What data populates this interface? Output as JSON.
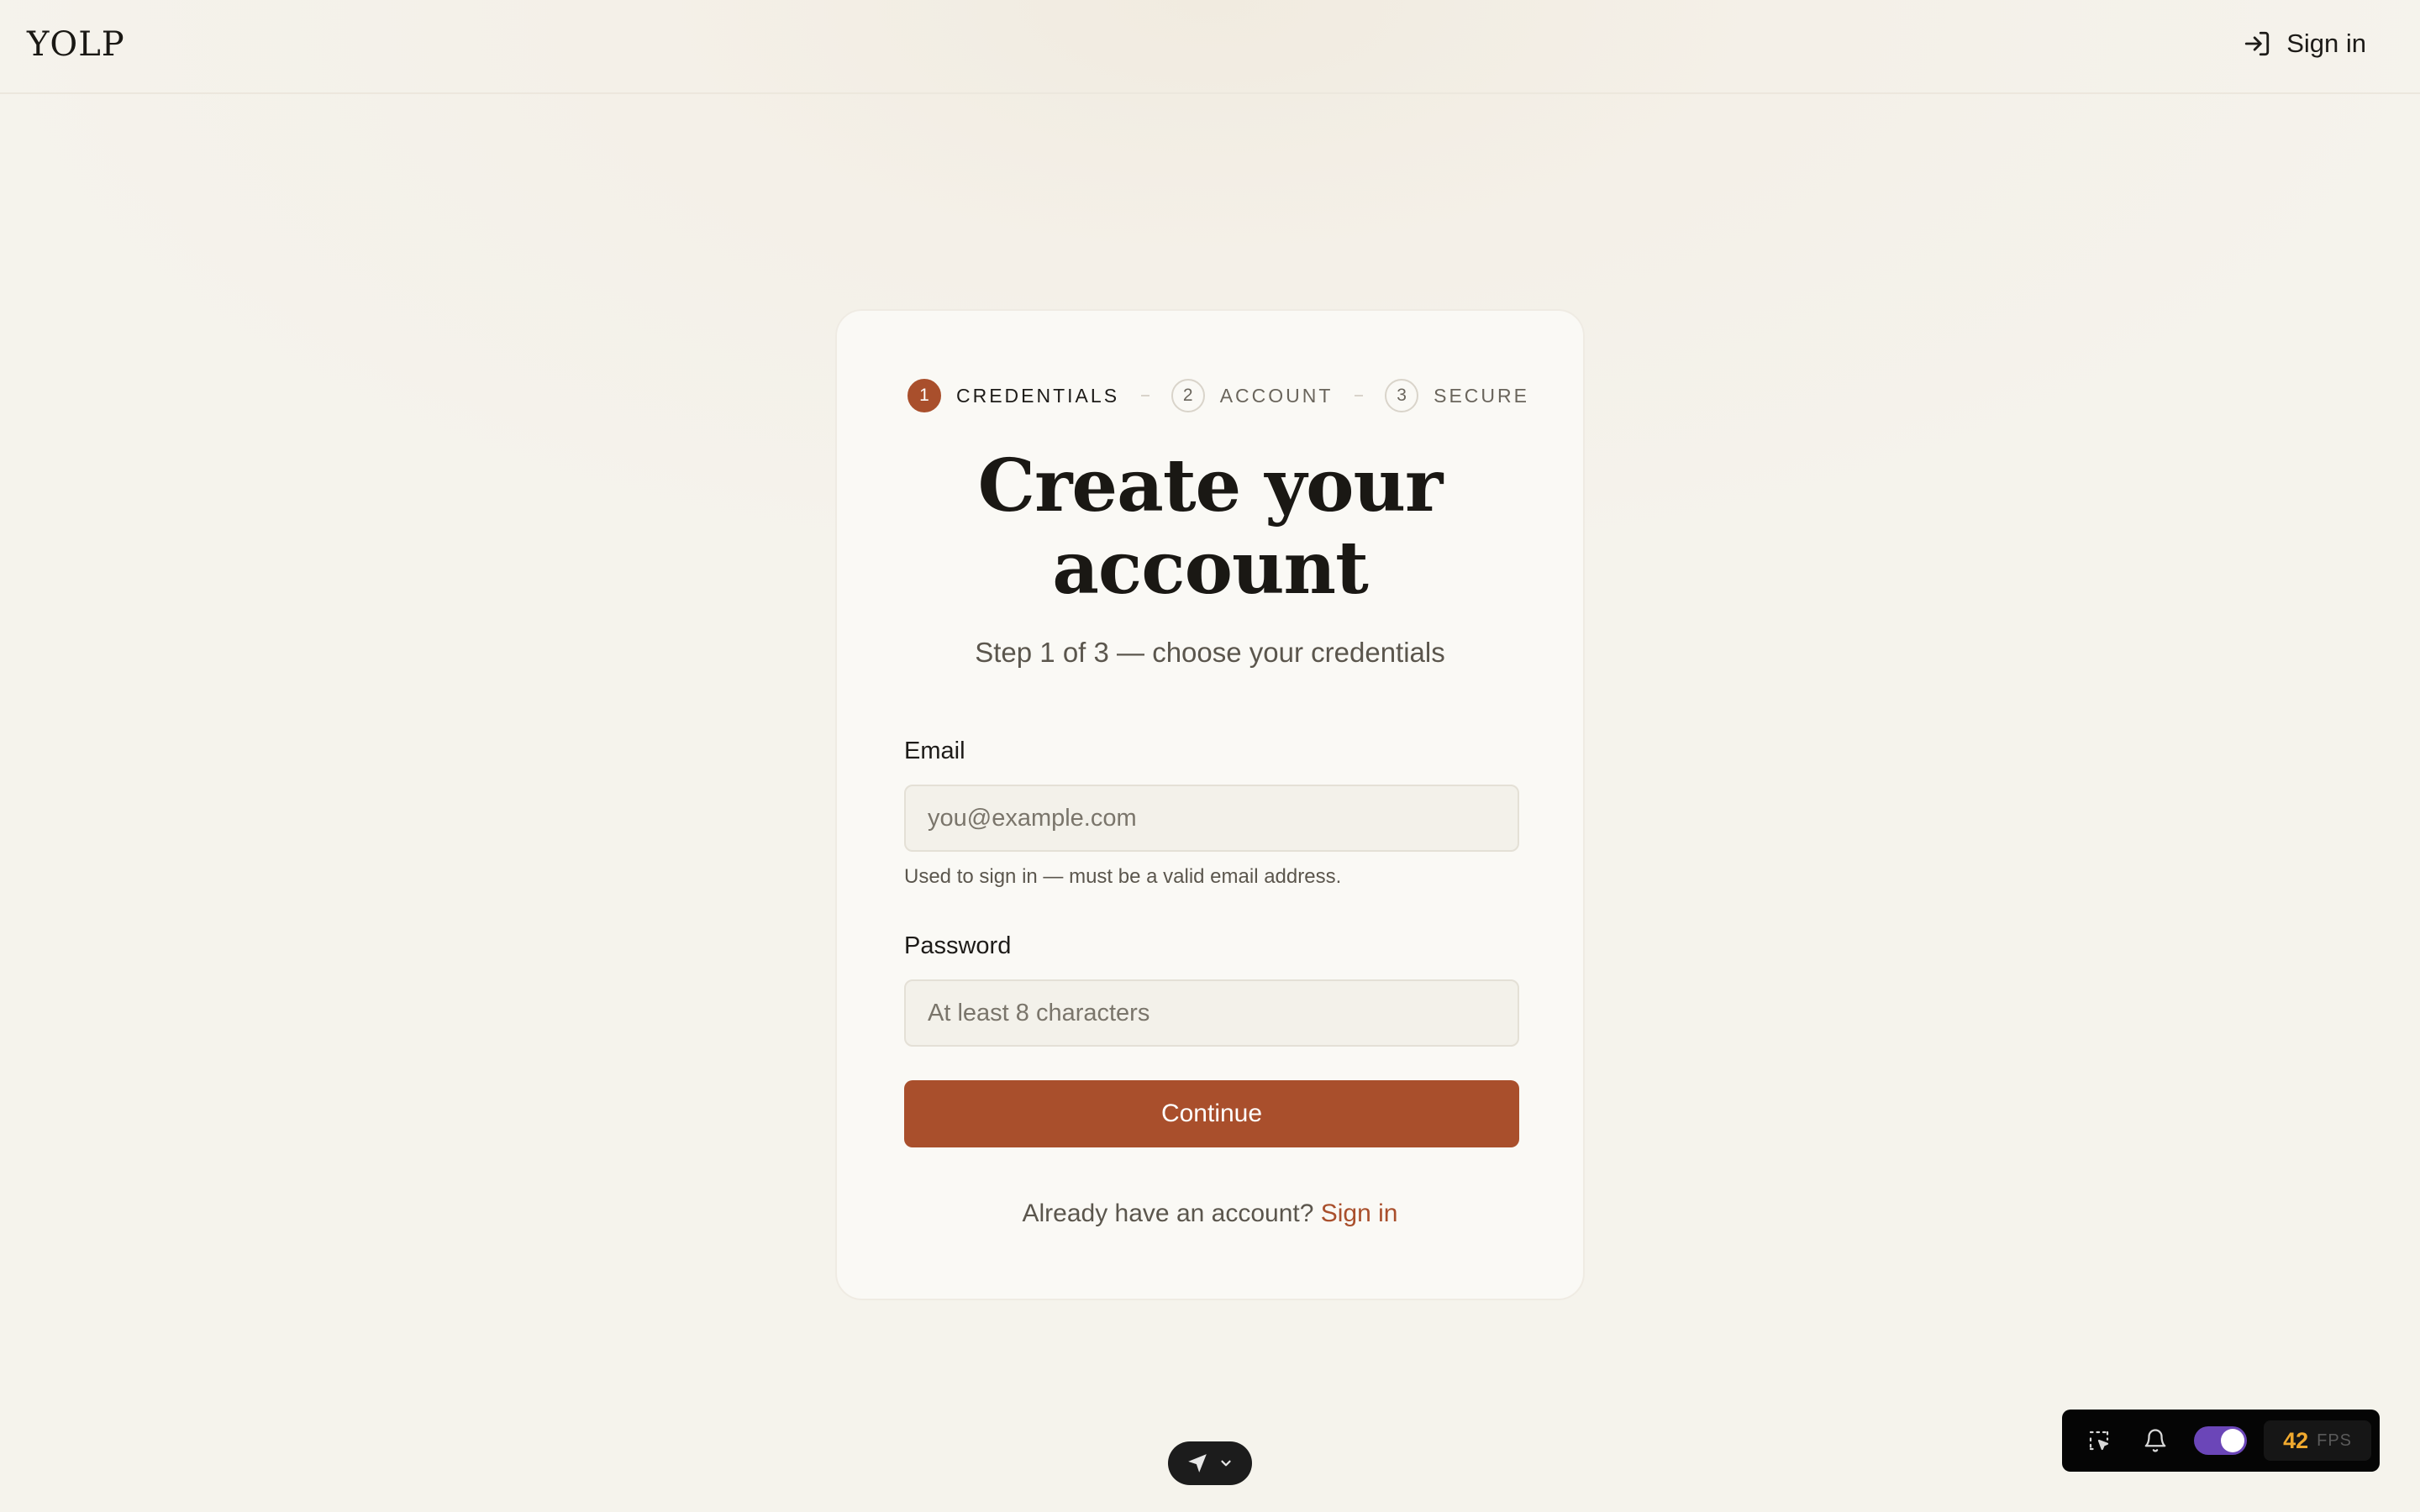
{
  "header": {
    "logo": "YOLP",
    "signin_label": "Sign in"
  },
  "stepper": {
    "steps": [
      {
        "number": "1",
        "label": "CREDENTIALS",
        "active": true
      },
      {
        "number": "2",
        "label": "ACCOUNT",
        "active": false
      },
      {
        "number": "3",
        "label": "SECURE",
        "active": false
      }
    ]
  },
  "form": {
    "title_line1": "Create your",
    "title_line2": "account",
    "subtitle": "Step 1 of 3 — choose your credentials",
    "email": {
      "label": "Email",
      "placeholder": "you@example.com",
      "value": "",
      "hint": "Used to sign in — must be a valid email address."
    },
    "password": {
      "label": "Password",
      "placeholder": "At least 8 characters",
      "value": ""
    },
    "continue_label": "Continue",
    "footer_text": "Already have an account?",
    "footer_link": "Sign in"
  },
  "devtools": {
    "fps_value": "42",
    "fps_unit": "FPS",
    "toggle_on": true
  },
  "colors": {
    "accent": "#a94f2c",
    "toggle": "#6b46b8",
    "fps": "#f0a92e"
  },
  "icons": {
    "header_signin": "login-icon",
    "pill_left": "send-icon",
    "pill_right": "chevron-down-icon",
    "devbar_select": "select-cursor-icon",
    "devbar_bell": "bell-icon"
  }
}
